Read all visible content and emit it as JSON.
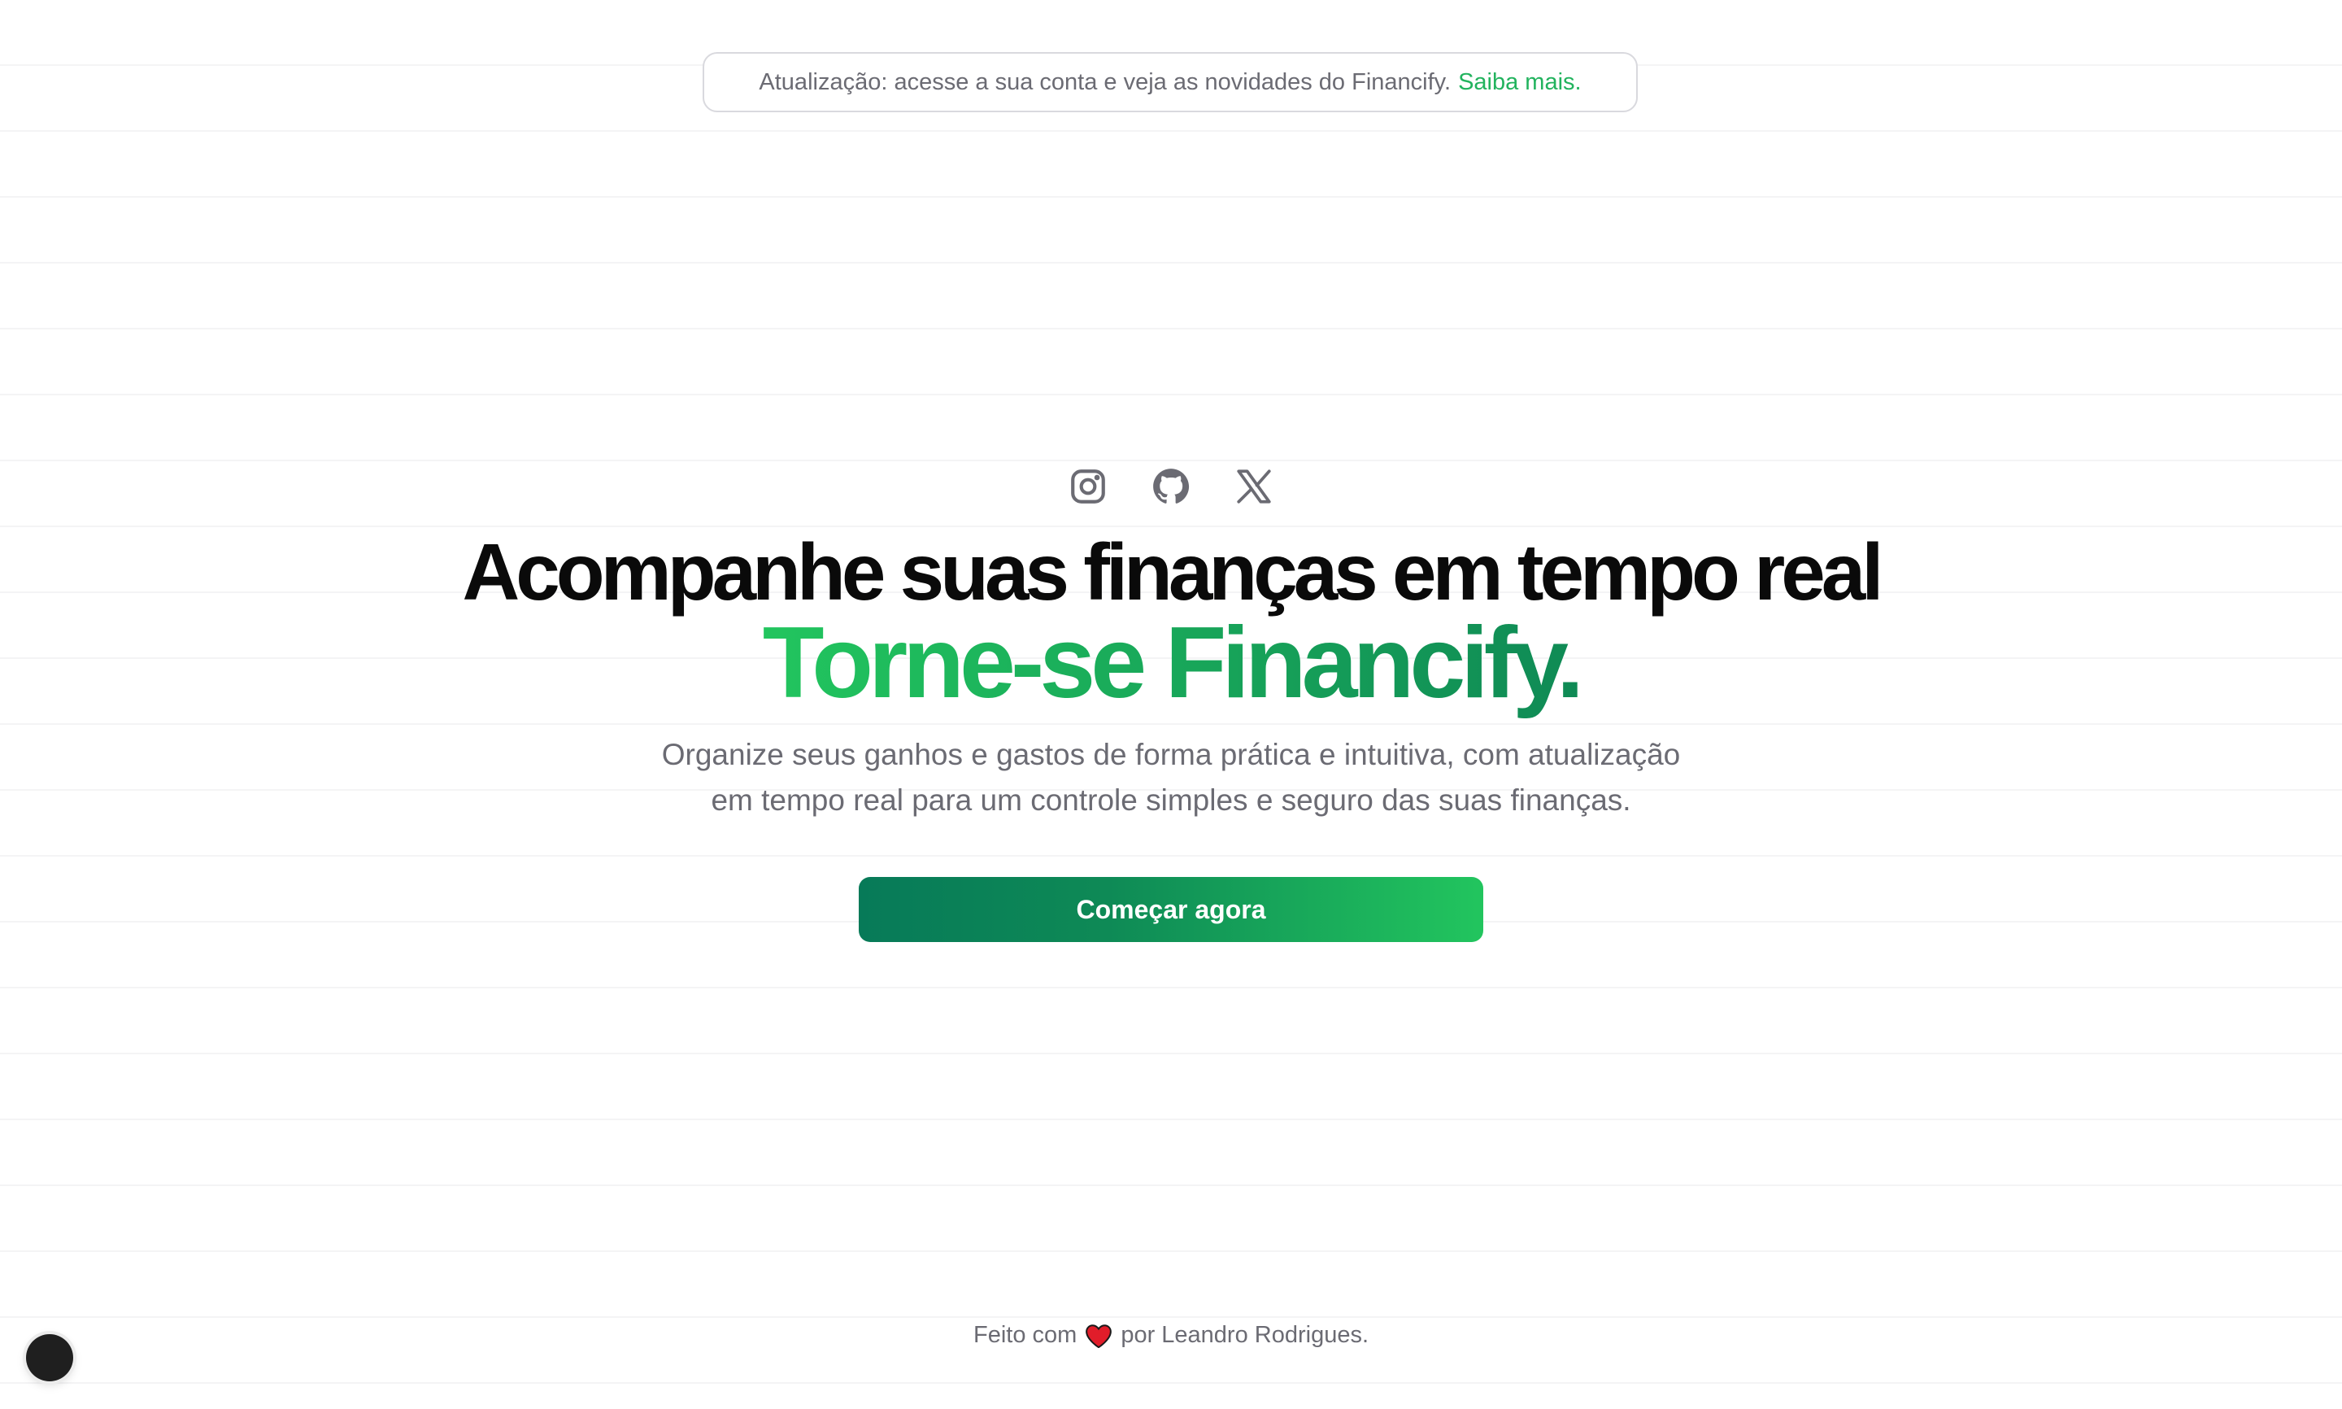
{
  "announcement": {
    "text": "Atualização: acesse a sua conta e veja as novidades do Financify.",
    "link_label": "Saiba mais."
  },
  "socials": [
    {
      "icon": "instagram-icon"
    },
    {
      "icon": "github-icon"
    },
    {
      "icon": "x-icon"
    }
  ],
  "hero": {
    "title": "Acompanhe suas finanças em tempo real",
    "title_accent": "Torne-se Financify.",
    "subtitle_line1": "Organize seus ganhos e gastos de forma prática e intuitiva, com atualização",
    "subtitle_line2": "em tempo real para um controle simples e seguro das suas finanças.",
    "cta_label": "Começar agora"
  },
  "footer": {
    "prefix": "Feito com",
    "suffix": "por Leandro Rodrigues."
  },
  "colors": {
    "accent": "#22c55e",
    "accent_dark": "#077a58",
    "heading": "#0a0a0a",
    "muted_text": "#6b6b73",
    "heart": "#e11d2a"
  }
}
